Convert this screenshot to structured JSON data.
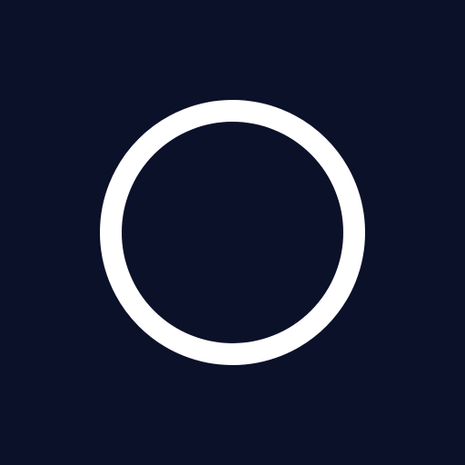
{
  "background_color": "#0c112a",
  "ring": {
    "icon": "circle-outline-icon",
    "color": "#ffffff"
  }
}
